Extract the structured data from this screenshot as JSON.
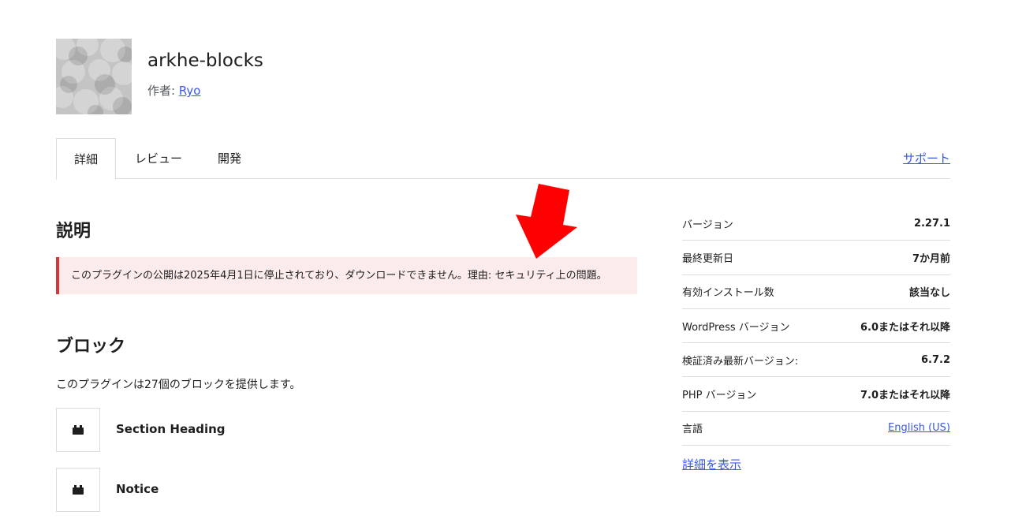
{
  "plugin": {
    "name": "arkhe-blocks",
    "author_label": "作者: ",
    "author_name": "Ryo"
  },
  "tabs": [
    {
      "label": "詳細",
      "active": true
    },
    {
      "label": "レビュー",
      "active": false
    },
    {
      "label": "開発",
      "active": false
    }
  ],
  "support_link": "サポート",
  "description": {
    "heading": "説明",
    "notice": "このプラグインの公開は2025年4月1日に停止されており、ダウンロードできません。理由: セキュリティ上の問題。"
  },
  "blocks": {
    "heading": "ブロック",
    "intro": "このプラグインは27個のブロックを提供します。",
    "items": [
      {
        "name": "Section Heading"
      },
      {
        "name": "Notice"
      }
    ]
  },
  "meta": {
    "rows": [
      {
        "label": "バージョン",
        "value": "2.27.1"
      },
      {
        "label": "最終更新日",
        "value": "7か月前"
      },
      {
        "label": "有効インストール数",
        "value": "該当なし"
      },
      {
        "label": "WordPress バージョン",
        "value": "6.0またはそれ以降"
      },
      {
        "label": "検証済み最新バージョン:",
        "value": "6.7.2"
      },
      {
        "label": "PHP バージョン",
        "value": "7.0またはそれ以降"
      },
      {
        "label": "言語",
        "value": "English (US)"
      }
    ],
    "more_link": "詳細を表示"
  },
  "colors": {
    "link": "#3858e9",
    "notice_bg": "#fcebeb",
    "notice_border": "#d63638",
    "annotation_arrow": "#ff0000"
  },
  "icons": {
    "block_icon": "block-default-icon",
    "annotation": "red-arrow-down-icon"
  }
}
